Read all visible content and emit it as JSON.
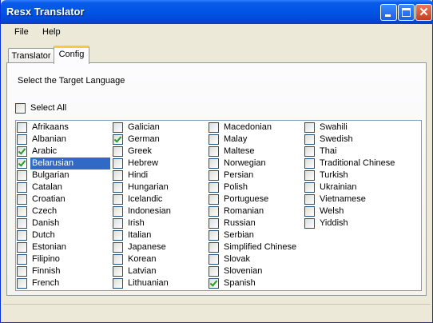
{
  "window": {
    "title": "Resx Translator"
  },
  "menu": {
    "file": "File",
    "help": "Help"
  },
  "tabs": {
    "translator": "Translator",
    "config": "Config",
    "active": "Config"
  },
  "config": {
    "prompt": "Select the Target Language",
    "select_all_label": "Select All",
    "select_all_checked": false,
    "columns": [
      [
        {
          "label": "Afrikaans",
          "checked": false
        },
        {
          "label": "Albanian",
          "checked": false
        },
        {
          "label": "Arabic",
          "checked": true
        },
        {
          "label": "Belarusian",
          "checked": true,
          "selected": true
        },
        {
          "label": "Bulgarian",
          "checked": false
        },
        {
          "label": "Catalan",
          "checked": false
        },
        {
          "label": "Croatian",
          "checked": false
        },
        {
          "label": "Czech",
          "checked": false
        },
        {
          "label": "Danish",
          "checked": false
        },
        {
          "label": "Dutch",
          "checked": false
        },
        {
          "label": "Estonian",
          "checked": false
        },
        {
          "label": "Filipino",
          "checked": false
        },
        {
          "label": "Finnish",
          "checked": false
        },
        {
          "label": "French",
          "checked": false
        }
      ],
      [
        {
          "label": "Galician",
          "checked": false
        },
        {
          "label": "German",
          "checked": true
        },
        {
          "label": "Greek",
          "checked": false
        },
        {
          "label": "Hebrew",
          "checked": false
        },
        {
          "label": "Hindi",
          "checked": false
        },
        {
          "label": "Hungarian",
          "checked": false
        },
        {
          "label": "Icelandic",
          "checked": false
        },
        {
          "label": "Indonesian",
          "checked": false
        },
        {
          "label": "Irish",
          "checked": false
        },
        {
          "label": "Italian",
          "checked": false
        },
        {
          "label": "Japanese",
          "checked": false
        },
        {
          "label": "Korean",
          "checked": false
        },
        {
          "label": "Latvian",
          "checked": false
        },
        {
          "label": "Lithuanian",
          "checked": false
        }
      ],
      [
        {
          "label": "Macedonian",
          "checked": false
        },
        {
          "label": "Malay",
          "checked": false
        },
        {
          "label": "Maltese",
          "checked": false
        },
        {
          "label": "Norwegian",
          "checked": false
        },
        {
          "label": "Persian",
          "checked": false
        },
        {
          "label": "Polish",
          "checked": false
        },
        {
          "label": "Portuguese",
          "checked": false
        },
        {
          "label": "Romanian",
          "checked": false
        },
        {
          "label": "Russian",
          "checked": false
        },
        {
          "label": "Serbian",
          "checked": false
        },
        {
          "label": "Simplified Chinese",
          "checked": false
        },
        {
          "label": "Slovak",
          "checked": false
        },
        {
          "label": "Slovenian",
          "checked": false
        },
        {
          "label": "Spanish",
          "checked": true
        }
      ],
      [
        {
          "label": "Swahili",
          "checked": false
        },
        {
          "label": "Swedish",
          "checked": false
        },
        {
          "label": "Thai",
          "checked": false
        },
        {
          "label": "Traditional Chinese",
          "checked": false
        },
        {
          "label": "Turkish",
          "checked": false
        },
        {
          "label": "Ukrainian",
          "checked": false
        },
        {
          "label": "Vietnamese",
          "checked": false
        },
        {
          "label": "Welsh",
          "checked": false
        },
        {
          "label": "Yiddish",
          "checked": false
        }
      ]
    ]
  }
}
